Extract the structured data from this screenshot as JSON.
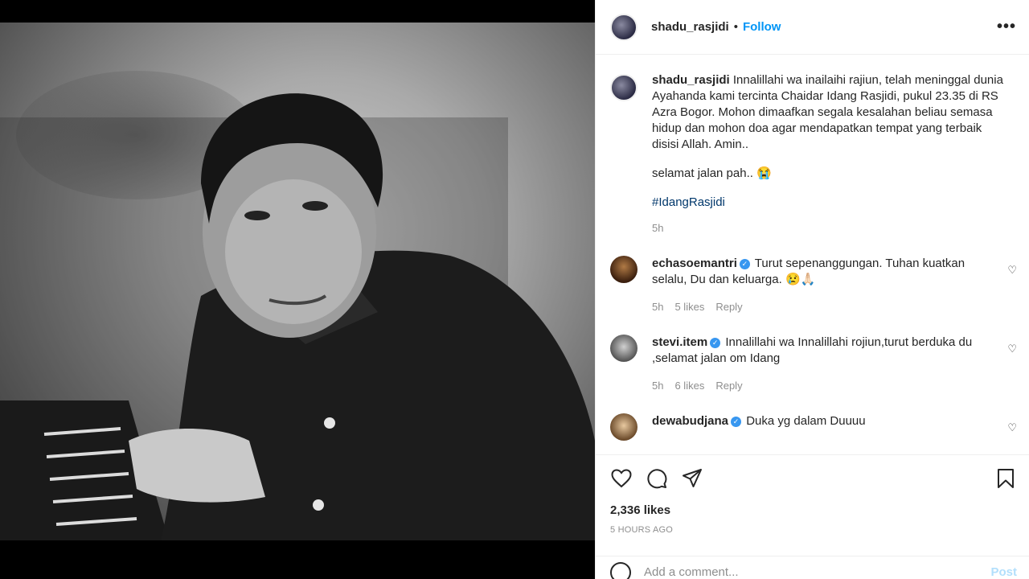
{
  "post": {
    "username": "shadu_rasjidi",
    "separator": "•",
    "follow_label": "Follow",
    "more_label": "•••",
    "caption": {
      "username": "shadu_rasjidi",
      "text": "Innalillahi wa inailaihi rajiun, telah meninggal dunia Ayahanda kami tercinta Chaidar Idang Rasjidi, pukul 23.35 di RS Azra Bogor. Mohon dimaafkan segala kesalahan beliau semasa hidup dan mohon doa agar mendapatkan tempat yang terbaik disisi Allah. Amin..",
      "extra": "selamat jalan pah.. 😭",
      "hashtag": "#IdangRasjidi",
      "time": "5h"
    },
    "comments": [
      {
        "username": "echasoemantri",
        "text": "Turut sepenanggungan. Tuhan kuatkan selalu, Du dan keluarga. 😢🙏🏻",
        "time": "5h",
        "likes": "5 likes",
        "reply": "Reply"
      },
      {
        "username": "stevi.item",
        "text": "Innalillahi wa Innalillahi rojiun,turut berduka du ,selamat jalan om Idang",
        "time": "5h",
        "likes": "6 likes",
        "reply": "Reply"
      },
      {
        "username": "dewabudjana",
        "text": "Duka yg dalam Duuuu",
        "time": "",
        "likes": "",
        "reply": ""
      }
    ],
    "likes_count": "2,336 likes",
    "posted_time": "5 HOURS AGO",
    "comment_placeholder": "Add a comment...",
    "post_label": "Post"
  },
  "colors": {
    "accent": "#0095f6",
    "verified": "#3897f0",
    "muted": "#8e8e8e",
    "hashtag": "#00376b"
  }
}
